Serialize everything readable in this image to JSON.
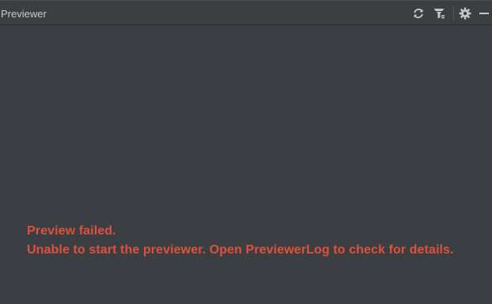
{
  "panel": {
    "title": "Previewer"
  },
  "toolbar": {
    "buttons": [
      {
        "icon": "refresh-icon"
      },
      {
        "icon": "filter-icon"
      },
      {
        "icon": "gear-icon"
      },
      {
        "icon": "minimize-icon"
      }
    ]
  },
  "message": {
    "line1": "Preview failed.",
    "line2": "Unable to start the previewer. Open PreviewerLog to check for details."
  },
  "colors": {
    "background": "#3b3f43",
    "error": "#e0503c",
    "title_text": "#c8c8c8",
    "icon": "#c8c8c8"
  }
}
